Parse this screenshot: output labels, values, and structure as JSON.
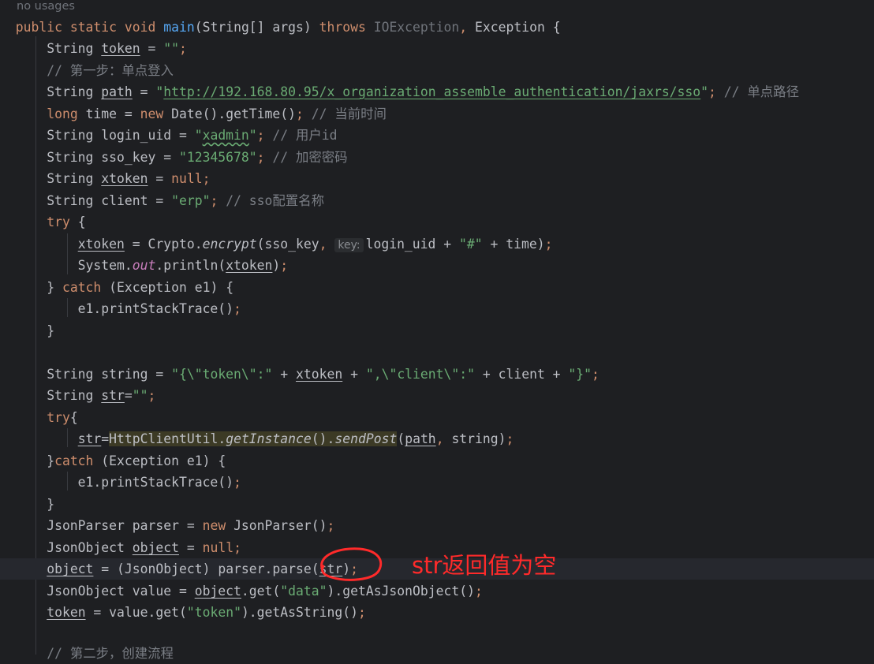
{
  "editor": {
    "usage_hint": "no usages",
    "strings": {
      "empty": "\"\"",
      "url": "http://192.168.80.95/x_organization_assemble_authentication/jaxrs/sso",
      "quote": "\"",
      "xadmin": "xadmin",
      "sso_key": "\"12345678\"",
      "erp": "\"erp\"",
      "hash": "\"#\"",
      "json_open": "\"{\\\"token\\\":\"",
      "json_mid": "\",\\\"client\\\":\"",
      "json_close": "\"}\"",
      "data": "\"data\"",
      "token": "\"token\""
    },
    "comments": {
      "step1": "// 第一步：单点登入",
      "sso_path": "// 单点路径",
      "current_time": "// 当前时间",
      "user_id": "// 用户id",
      "encrypt_key": "// 加密密码",
      "sso_config": "// sso配置名称",
      "step2": "// 第二步，创建流程"
    },
    "param_hint": "key:"
  },
  "annotation": {
    "text": "str返回值为空",
    "color": "#ff2a2a"
  }
}
